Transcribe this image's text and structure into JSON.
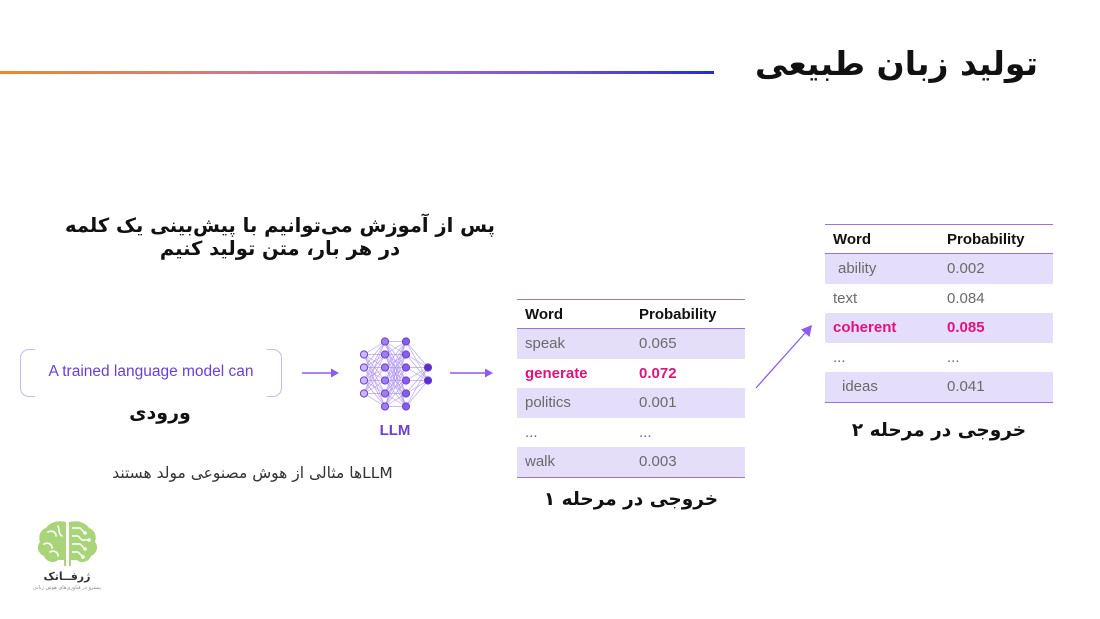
{
  "slide": {
    "title": "تولید زبان طبیعی",
    "lead_text": "پس از آموزش می‌توانیم با پیش‌بینی یک کلمه در هر بار، متن تولید کنیم",
    "caption": "LLMها مثالی از هوش مصنوعی مولد هستند",
    "accent_color": "#6A3FD6",
    "highlight_color": "#E0127D",
    "rule_gradient": [
      "#E8892F",
      "#C26FAE",
      "#1F2FD0"
    ]
  },
  "input": {
    "prompt_text": "A trained language model can",
    "label": "ورودی"
  },
  "llm": {
    "label": "LLM",
    "icon": "neural-network-icon",
    "layers": [
      4,
      6,
      6,
      2
    ]
  },
  "step1": {
    "caption": "خروجی در مرحله ۱",
    "headers": [
      "Word",
      "Probability"
    ],
    "rows": [
      {
        "word": "speak",
        "prob": "0.065",
        "highlight": false
      },
      {
        "word": "generate",
        "prob": "0.072",
        "highlight": true
      },
      {
        "word": "politics",
        "prob": "0.001",
        "highlight": false
      },
      {
        "word": "...",
        "prob": "...",
        "highlight": false
      },
      {
        "word": "walk",
        "prob": "0.003",
        "highlight": false
      }
    ]
  },
  "step2": {
    "caption": "خروجی در مرحله ۲",
    "headers": [
      "Word",
      "Probability"
    ],
    "rows": [
      {
        "word": "ability",
        "prob": "0.002",
        "highlight": false
      },
      {
        "word": "text",
        "prob": "0.084",
        "highlight": false
      },
      {
        "word": "coherent",
        "prob": "0.085",
        "highlight": true
      },
      {
        "word": "...",
        "prob": "...",
        "highlight": false
      },
      {
        "word": "ideas",
        "prob": "0.041",
        "highlight": false
      }
    ]
  },
  "logo": {
    "name": "ژرفــاتک",
    "tagline": "پیشرو در فناوری‌های هوش زبانی",
    "icon": "brain-circuit-icon",
    "color": "#9BCB6A"
  }
}
